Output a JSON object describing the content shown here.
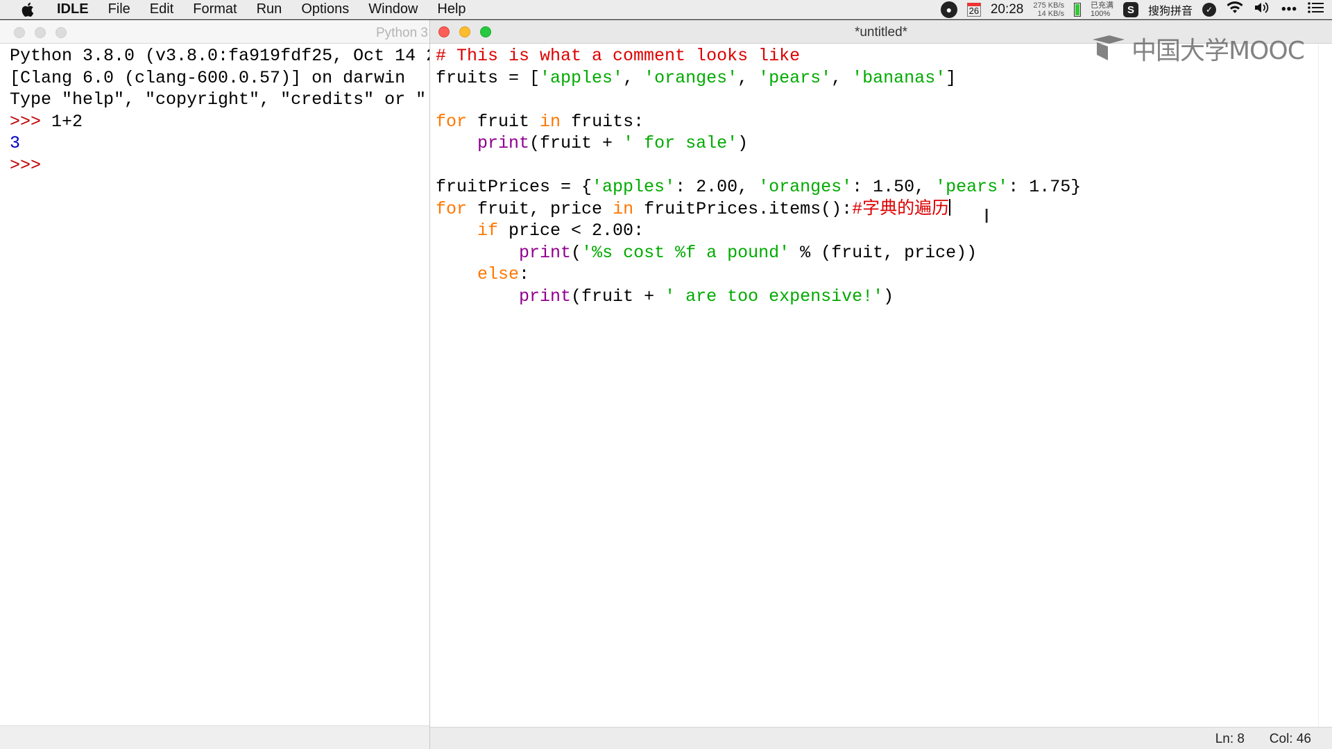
{
  "menubar": {
    "app": "IDLE",
    "items": [
      "File",
      "Edit",
      "Format",
      "Run",
      "Options",
      "Window",
      "Help"
    ],
    "status": {
      "calendar_day": "26",
      "time": "20:28",
      "net_up": "275 KB/s",
      "net_down": "14 KB/s",
      "battery_label": "已充满",
      "battery_pct": "100%",
      "ime": "搜狗拼音",
      "ime_icon_letter": "S"
    }
  },
  "shell": {
    "title": "Python 3",
    "lines": [
      {
        "text": "Python 3.8.0 (v3.8.0:fa919fdf25, Oct 14 2",
        "cls": ""
      },
      {
        "text": "[Clang 6.0 (clang-600.0.57)] on darwin",
        "cls": ""
      },
      {
        "text": "Type \"help\", \"copyright\", \"credits\" or \"",
        "cls": ""
      },
      {
        "prompt": ">>> ",
        "text": "1+2",
        "cls": ""
      },
      {
        "text": "3",
        "cls": "out"
      },
      {
        "prompt": ">>> ",
        "text": "",
        "cls": ""
      }
    ]
  },
  "editor": {
    "title": "*untitled*",
    "code": [
      [
        [
          "cmt",
          "# This is what a comment looks like"
        ]
      ],
      [
        [
          "",
          "fruits = ["
        ],
        [
          "str",
          "'apples'"
        ],
        [
          "",
          ", "
        ],
        [
          "str",
          "'oranges'"
        ],
        [
          "",
          ", "
        ],
        [
          "str",
          "'pears'"
        ],
        [
          "",
          ", "
        ],
        [
          "str",
          "'bananas'"
        ],
        [
          "",
          "]"
        ]
      ],
      [],
      [
        [
          "kw",
          "for"
        ],
        [
          "",
          " fruit "
        ],
        [
          "kw",
          "in"
        ],
        [
          "",
          " fruits:"
        ]
      ],
      [
        [
          "",
          "    "
        ],
        [
          "bi",
          "print"
        ],
        [
          "",
          "(fruit + "
        ],
        [
          "str",
          "' for sale'"
        ],
        [
          "",
          ")"
        ]
      ],
      [],
      [
        [
          "",
          "fruitPrices = {"
        ],
        [
          "str",
          "'apples'"
        ],
        [
          "",
          ": 2.00, "
        ],
        [
          "str",
          "'oranges'"
        ],
        [
          "",
          ": 1.50, "
        ],
        [
          "str",
          "'pears'"
        ],
        [
          "",
          ": 1.75}"
        ]
      ],
      [
        [
          "kw",
          "for"
        ],
        [
          "",
          " fruit, price "
        ],
        [
          "kw",
          "in"
        ],
        [
          "",
          " fruitPrices.items():"
        ],
        [
          "cmt",
          "#字典的遍历"
        ],
        [
          "caret",
          ""
        ]
      ],
      [
        [
          "",
          "    "
        ],
        [
          "kw",
          "if"
        ],
        [
          "",
          " price < 2.00:"
        ]
      ],
      [
        [
          "",
          "        "
        ],
        [
          "bi",
          "print"
        ],
        [
          "",
          "("
        ],
        [
          "str",
          "'%s cost %f a pound'"
        ],
        [
          "",
          " % (fruit, price))"
        ]
      ],
      [
        [
          "",
          "    "
        ],
        [
          "kw",
          "else"
        ],
        [
          "",
          ":"
        ]
      ],
      [
        [
          "",
          "        "
        ],
        [
          "bi",
          "print"
        ],
        [
          "",
          "(fruit + "
        ],
        [
          "str",
          "' are too expensive!'"
        ],
        [
          "",
          ")"
        ]
      ]
    ],
    "status_ln": "Ln: 8",
    "status_col": "Col: 46"
  },
  "watermark": "中国大学MOOC",
  "icons": {
    "apple": "apple-icon",
    "wifi": "wifi-icon",
    "volume": "volume-icon",
    "more": "more-icon",
    "list": "notification-list-icon"
  }
}
